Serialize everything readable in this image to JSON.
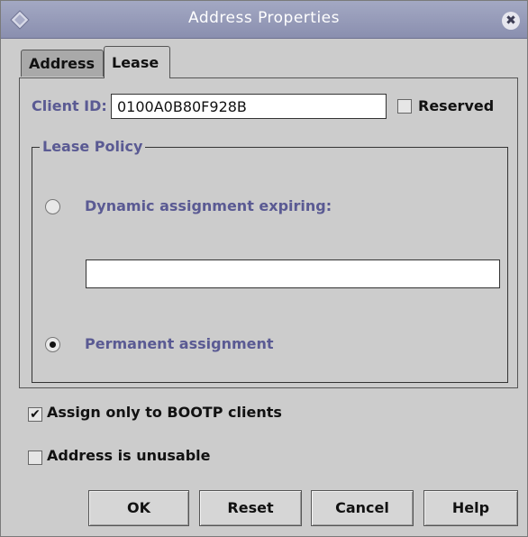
{
  "window": {
    "title": "Address Properties",
    "close_glyph": "✖",
    "accent_color": "#8a8faf",
    "label_color": "#5a5a93"
  },
  "tabs": [
    {
      "label": "Address",
      "selected": false
    },
    {
      "label": "Lease",
      "selected": true
    }
  ],
  "client": {
    "label": "Client ID:",
    "value": "0100A0B80F928B",
    "reserved_label": "Reserved",
    "reserved_checked": false
  },
  "lease_policy": {
    "title": "Lease Policy",
    "dynamic_label": "Dynamic assignment expiring:",
    "dynamic_selected": false,
    "expiration_value": "",
    "permanent_label": "Permanent assignment",
    "permanent_selected": true
  },
  "options": {
    "bootp_label": "Assign only to BOOTP clients",
    "bootp_checked": true,
    "bootp_glyph": "✔",
    "unusable_label": "Address is unusable",
    "unusable_checked": false
  },
  "buttons": {
    "ok": "OK",
    "reset": "Reset",
    "cancel": "Cancel",
    "help": "Help"
  }
}
